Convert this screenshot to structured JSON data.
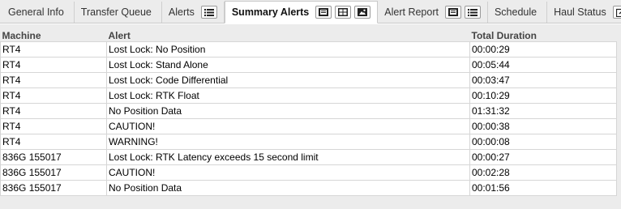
{
  "tabs": [
    {
      "label": "General Info",
      "active": false,
      "icons": []
    },
    {
      "label": "Transfer Queue",
      "active": false,
      "icons": []
    },
    {
      "label": "Alerts",
      "active": false,
      "icons": [
        "list-icon"
      ]
    },
    {
      "label": "Summary Alerts",
      "active": true,
      "icons": [
        "pdf-icon",
        "grid-icon",
        "image-icon"
      ]
    },
    {
      "label": "Alert Report",
      "active": false,
      "icons": [
        "pdf-icon",
        "list-icon"
      ]
    },
    {
      "label": "Schedule",
      "active": false,
      "icons": []
    },
    {
      "label": "Haul Status",
      "active": false,
      "icons": [
        "popout-icon"
      ]
    }
  ],
  "table": {
    "columns": [
      "Machine",
      "Alert",
      "Total Duration"
    ],
    "rows": [
      [
        "RT4",
        "Lost Lock: No Position",
        "00:00:29"
      ],
      [
        "RT4",
        "Lost Lock: Stand Alone",
        "00:05:44"
      ],
      [
        "RT4",
        "Lost Lock: Code Differential",
        "00:03:47"
      ],
      [
        "RT4",
        "Lost Lock: RTK Float",
        "00:10:29"
      ],
      [
        "RT4",
        "No Position Data",
        "01:31:32"
      ],
      [
        "RT4",
        "CAUTION!",
        "00:00:38"
      ],
      [
        "RT4",
        "WARNING!",
        "00:00:08"
      ],
      [
        "836G 155017",
        "Lost Lock: RTK Latency exceeds 15 second limit",
        "00:00:27"
      ],
      [
        "836G 155017",
        "CAUTION!",
        "00:02:28"
      ],
      [
        "836G 155017",
        "No Position Data",
        "00:01:56"
      ]
    ]
  }
}
